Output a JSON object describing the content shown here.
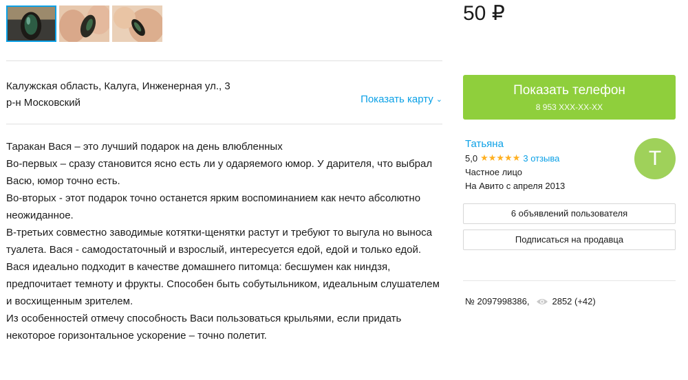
{
  "gallery": {
    "thumbnails": [
      {
        "name": "cockroach-photo-1",
        "active": true
      },
      {
        "name": "cockroach-photo-2",
        "active": false
      },
      {
        "name": "cockroach-photo-3",
        "active": false
      }
    ]
  },
  "location": {
    "address_line": "Калужская область, Калуга, Инженерная ул., 3",
    "district": "р-н Московский",
    "show_map_label": "Показать карту"
  },
  "description": [
    "Таракан Вася – это лучший подарок на день влюбленных",
    "Во-первых – сразу становится ясно есть ли у одаряемого юмор. У дарителя, что выбрал Васю, юмор точно есть.",
    "Во-вторых - этот подарок точно останется ярким воспоминанием как нечто абсолютно неожиданное.",
    "В-третьих совместно заводимые котятки-щенятки растут и требуют то выгула но выноса туалета. Вася - самодостаточный и взрослый, интересуется едой, едой и только едой.",
    "Вася идеально подходит в качестве домашнего питомца: бесшумен как ниндзя, предпочитает темноту и фрукты. Способен быть собутыльником, идеальным слушателем и восхищенным зрителем.",
    "Из особенностей отмечу способность Васи пользоваться крыльями, если придать некоторое горизонтальное ускорение – точно полетит."
  ],
  "price": "50 ₽",
  "phone_button": {
    "label": "Показать телефон",
    "masked_number": "8 953 XXX-XX-XX"
  },
  "seller": {
    "name": "Татьяна",
    "rating": "5,0",
    "stars": "★★★★★",
    "reviews": "3 отзыва",
    "type": "Частное лицо",
    "since": "На Авито с апреля 2013",
    "avatar_letter": "T",
    "avatar_color": "#9fd15a"
  },
  "buttons": {
    "user_ads": "6 объявлений пользователя",
    "subscribe": "Подписаться на продавца"
  },
  "meta": {
    "ad_number": "№ 2097998386,",
    "views": "2852 (+42)"
  },
  "colors": {
    "accent_link": "#0aa0e6",
    "phone_button": "#8fcf3c",
    "star": "#ffb021"
  }
}
